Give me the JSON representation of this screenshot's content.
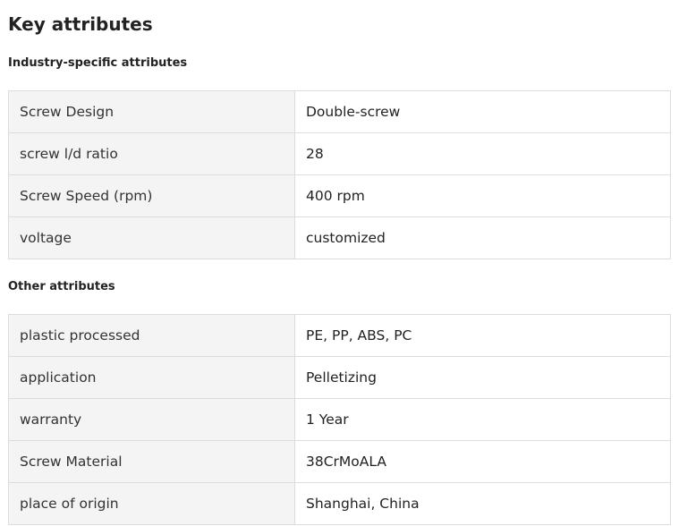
{
  "page": {
    "title": "Key attributes"
  },
  "sections": [
    {
      "title": "Industry-specific attributes",
      "rows": [
        {
          "label": "Screw Design",
          "value": "Double-screw"
        },
        {
          "label": "screw l/d ratio",
          "value": "28"
        },
        {
          "label": "Screw Speed (rpm)",
          "value": "400 rpm"
        },
        {
          "label": "voltage",
          "value": "customized"
        }
      ]
    },
    {
      "title": "Other attributes",
      "rows": [
        {
          "label": "plastic processed",
          "value": "PE, PP, ABS, PC"
        },
        {
          "label": "application",
          "value": "Pelletizing"
        },
        {
          "label": "warranty",
          "value": "1 Year"
        },
        {
          "label": "Screw Material",
          "value": "38CrMoALA"
        },
        {
          "label": "place of origin",
          "value": "Shanghai, China"
        }
      ]
    }
  ],
  "colors": {
    "label_cell_bg": "#f4f4f4",
    "value_cell_bg": "#ffffff",
    "border": "#dddddd",
    "text": "#222222"
  }
}
